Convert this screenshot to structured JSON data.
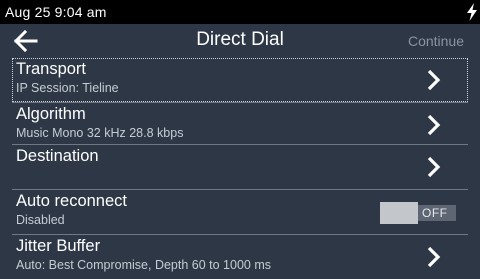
{
  "status": {
    "time": "Aug 25 9:04 am",
    "charging_icon": "bolt-icon"
  },
  "header": {
    "back_icon": "arrow-left-icon",
    "title": "Direct Dial",
    "continue_label": "Continue"
  },
  "items": [
    {
      "title": "Transport",
      "subtitle": "IP Session: Tieline",
      "control": "chevron",
      "focused": true
    },
    {
      "title": "Algorithm",
      "subtitle": "Music Mono 32 kHz 28.8 kbps",
      "control": "chevron"
    },
    {
      "title": "Destination",
      "subtitle": "",
      "control": "chevron"
    },
    {
      "title": "Auto reconnect",
      "subtitle": "Disabled",
      "control": "toggle",
      "toggle_label": "OFF",
      "toggle_on": false
    },
    {
      "title": "Jitter Buffer",
      "subtitle": "Auto: Best Compromise,  Depth 60 to 1000 ms",
      "control": "chevron"
    }
  ],
  "colors": {
    "background": "#2d3746",
    "status_bar": "#000000",
    "divider": "#6f7886",
    "muted_text": "#8a93a0"
  }
}
